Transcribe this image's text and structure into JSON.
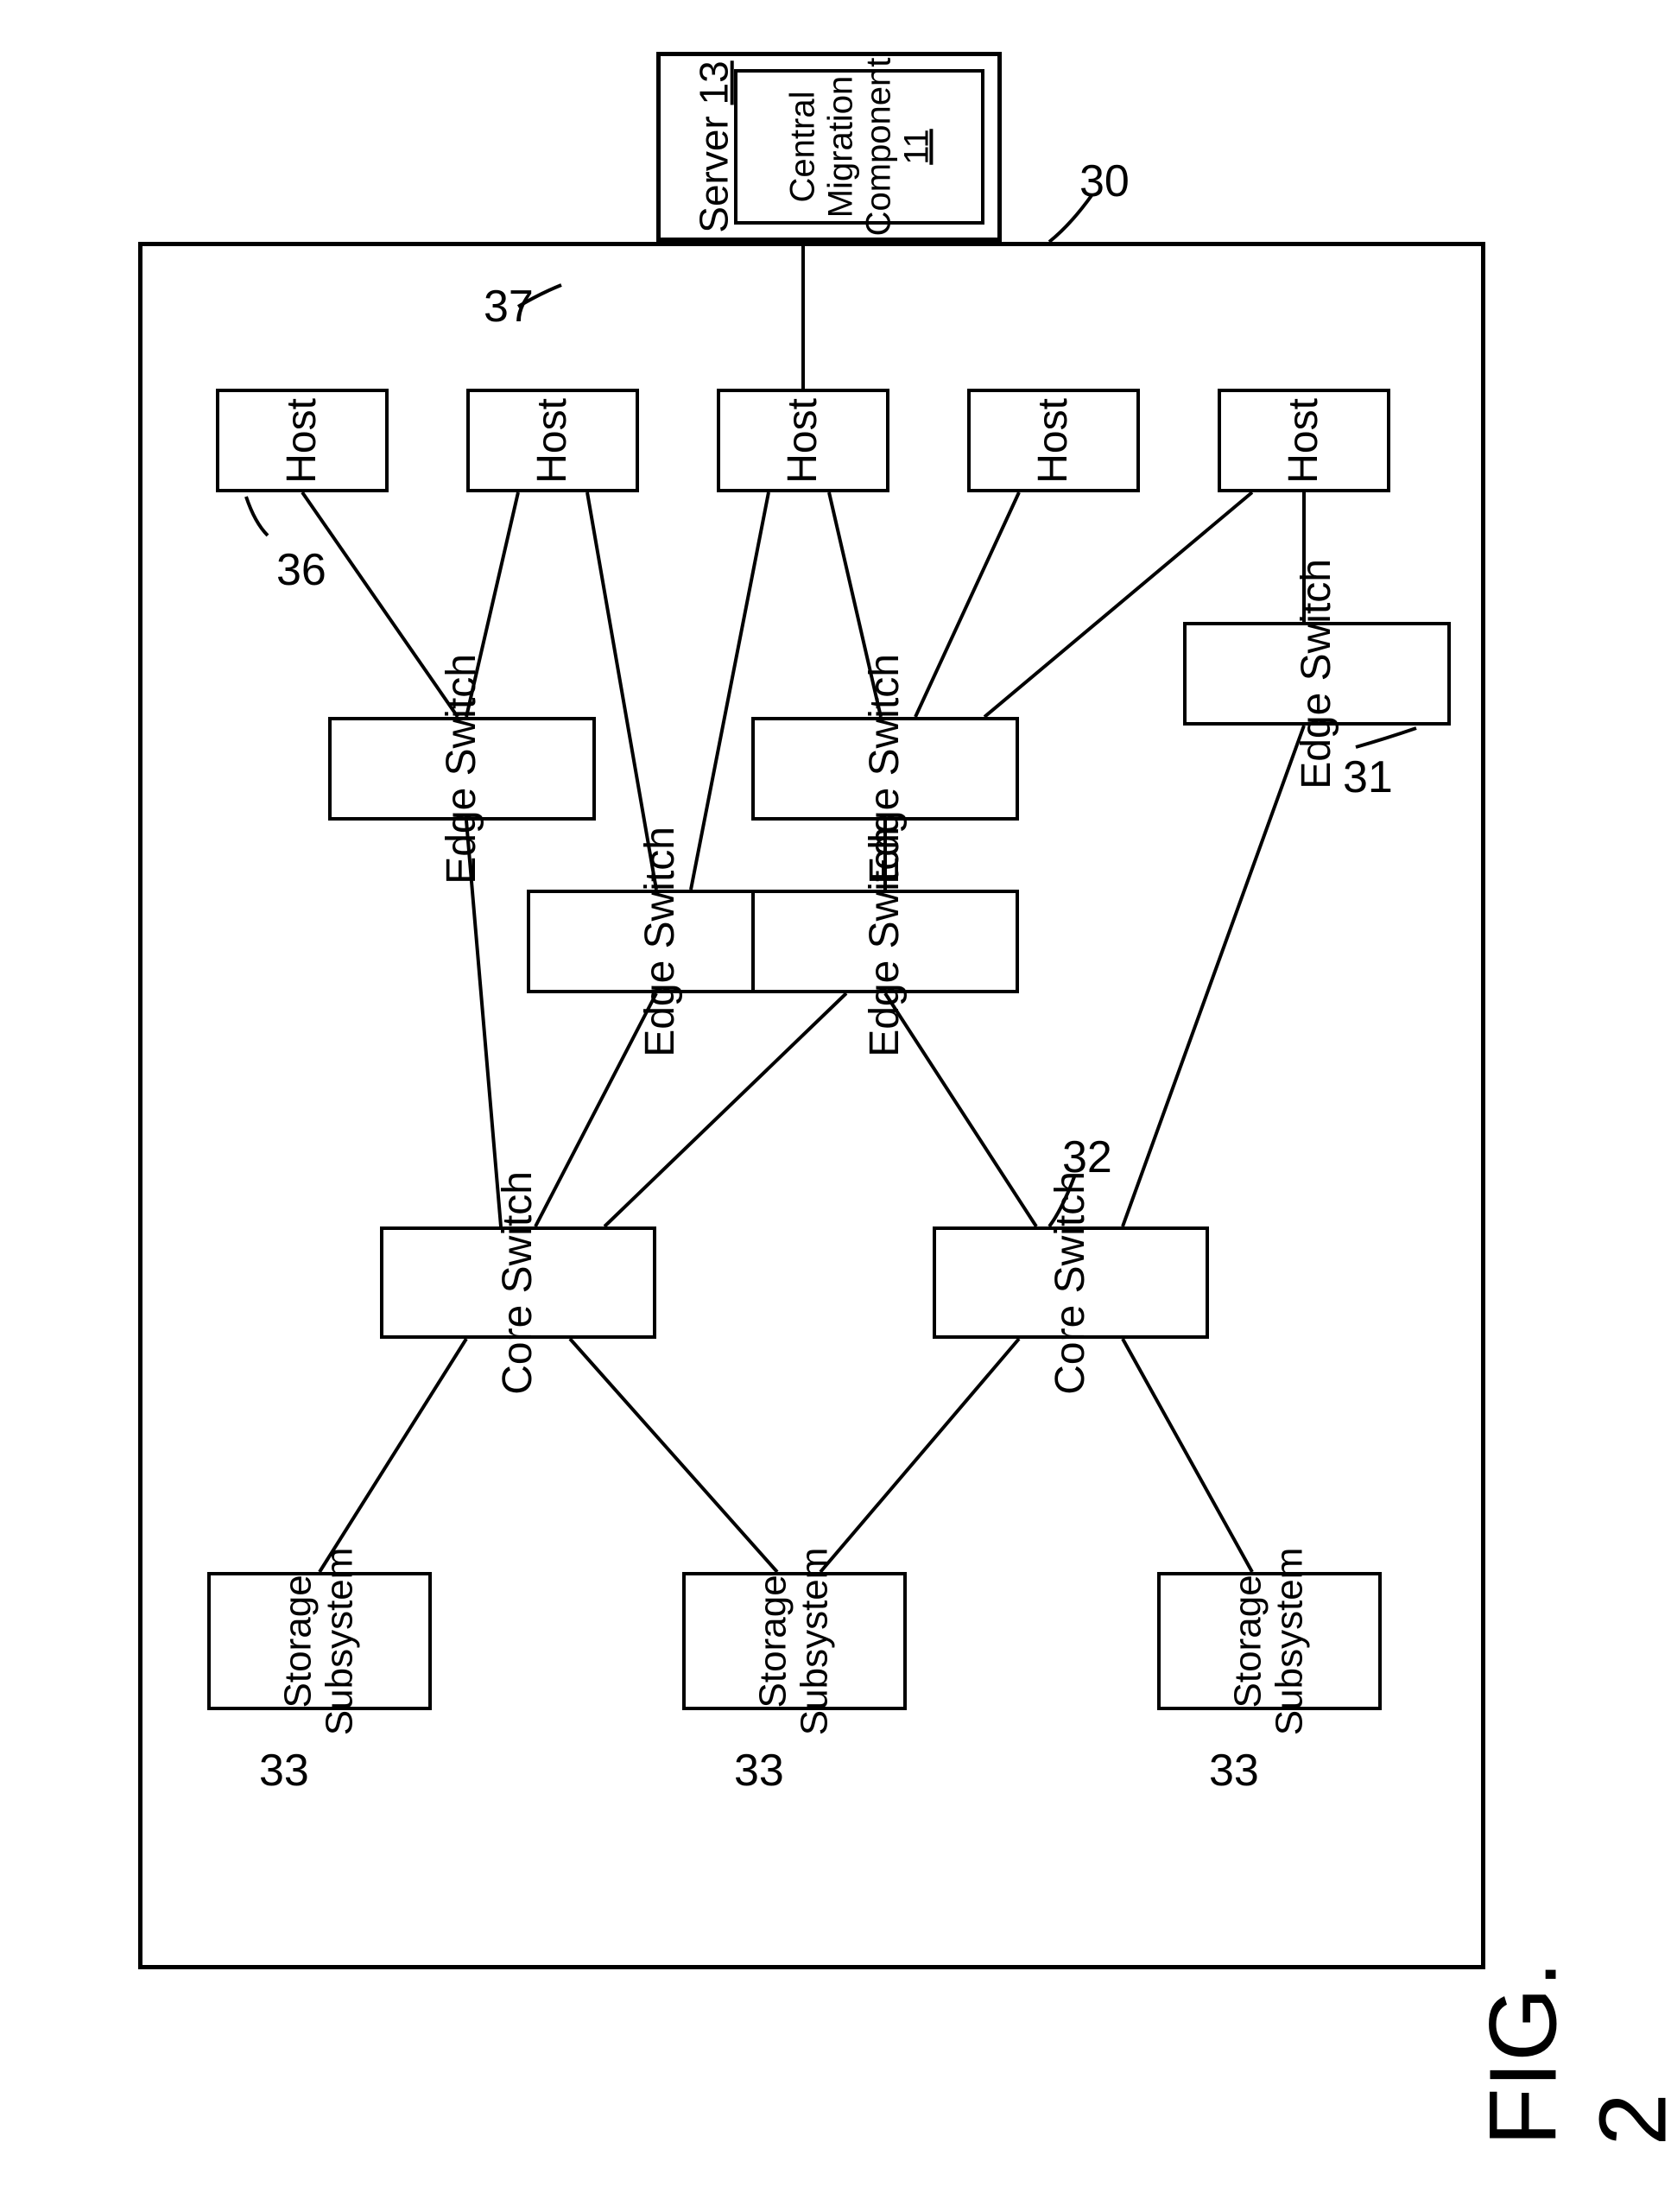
{
  "diagram": {
    "figure_label": "FIG. 2",
    "system_ref": "30",
    "outer_port_ref": "37",
    "host_ref": "36",
    "edge_switch_ref": "31",
    "core_switch_ref": "32",
    "storage_refs": [
      "33",
      "33",
      "33"
    ],
    "server": {
      "title": "Server",
      "id": "13",
      "component": {
        "line1": "Central",
        "line2": "Migration",
        "line3": "Component",
        "id": "11"
      }
    },
    "hosts": [
      "Host",
      "Host",
      "Host",
      "Host",
      "Host"
    ],
    "edge_switches": [
      "Edge Switch",
      "Edge Switch",
      "Edge Switch",
      "Edge Switch",
      "Edge Switch"
    ],
    "core_switches": [
      "Core Switch",
      "Core Switch"
    ],
    "storage": [
      "Storage\nSubsystem",
      "Storage\nSubsystem",
      "Storage\nSubsystem"
    ]
  }
}
